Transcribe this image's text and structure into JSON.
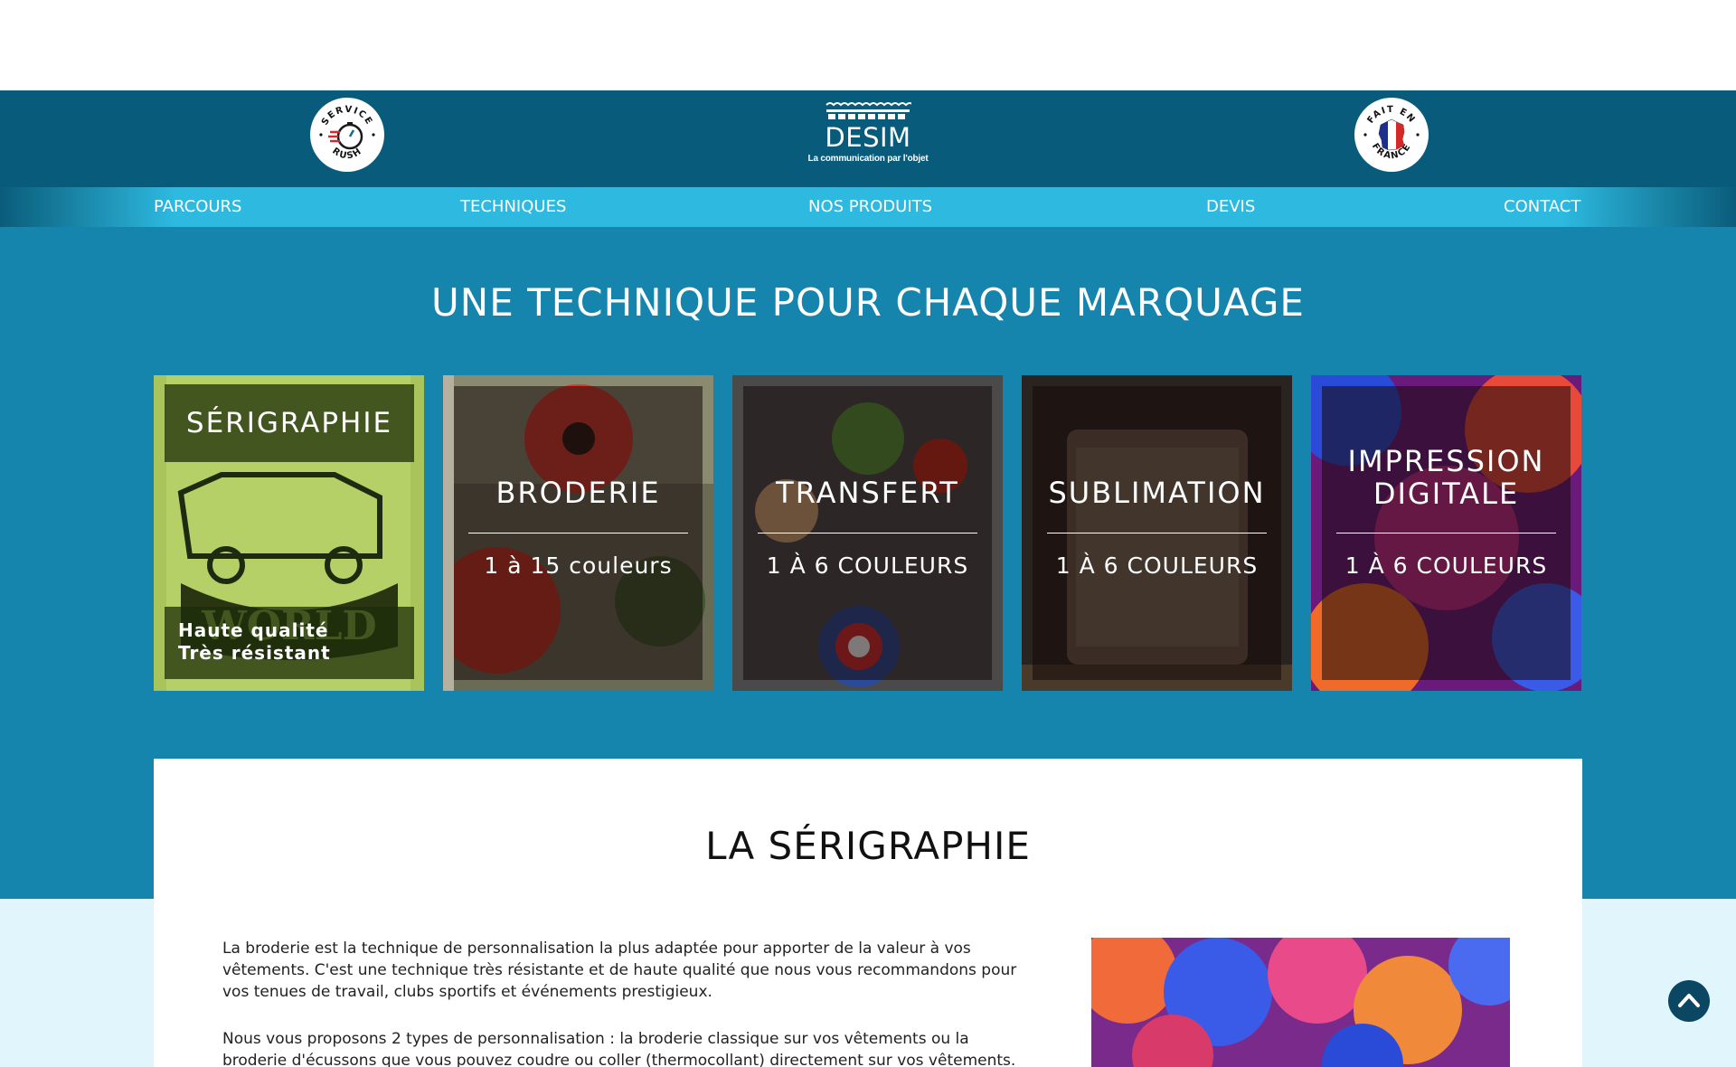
{
  "header": {
    "logo_name": "DESIM",
    "logo_tagline": "La communication par l'objet",
    "badge_left": "SERVICE RUSH",
    "badge_right": "FAIT EN FRANCE"
  },
  "nav": {
    "items": [
      "PARCOURS",
      "TECHNIQUES",
      "NOS PRODUITS",
      "DEVIS",
      "CONTACT"
    ]
  },
  "section_title": "UNE TECHNIQUE POUR CHAQUE MARQUAGE",
  "cards": [
    {
      "title": "SÉRIGRAPHIE",
      "lines": [
        "Haute qualité",
        "Très résistant"
      ]
    },
    {
      "title": "BRODERIE",
      "subtitle": "1 à 15 couleurs"
    },
    {
      "title": "TRANSFERT",
      "subtitle": "1 À 6 COULEURS"
    },
    {
      "title": "SUBLIMATION",
      "subtitle": "1 À 6 COULEURS"
    },
    {
      "title_line1": "IMPRESSION",
      "title_line2": "DIGITALE",
      "subtitle": "1 À 6 COULEURS"
    }
  ],
  "content": {
    "title": "LA SÉRIGRAPHIE",
    "p1": "La broderie est la technique de personnalisation la plus adaptée pour apporter de la valeur à vos vêtements. C'est une technique très résistante et de haute qualité que nous vous recommandons pour vos tenues de travail, clubs sportifs et événements prestigieux.",
    "p2": "Nous vous proposons 2 types de personnalisation : la broderie classique sur vos vêtements ou la broderie d'écussons que vous pouvez coudre ou coller (thermocollant) directement sur vos vêtements."
  },
  "colors": {
    "header_bg": "#085b7a",
    "nav_bg": "#2db9e0",
    "section_bg": "#1685ad",
    "light_bg": "#e0f6fc",
    "scroll_button": "#0b4762"
  },
  "icons": {
    "scroll_top": "chevron-up-icon",
    "badge_rush": "stopwatch-icon",
    "badge_france": "france-map-icon"
  }
}
